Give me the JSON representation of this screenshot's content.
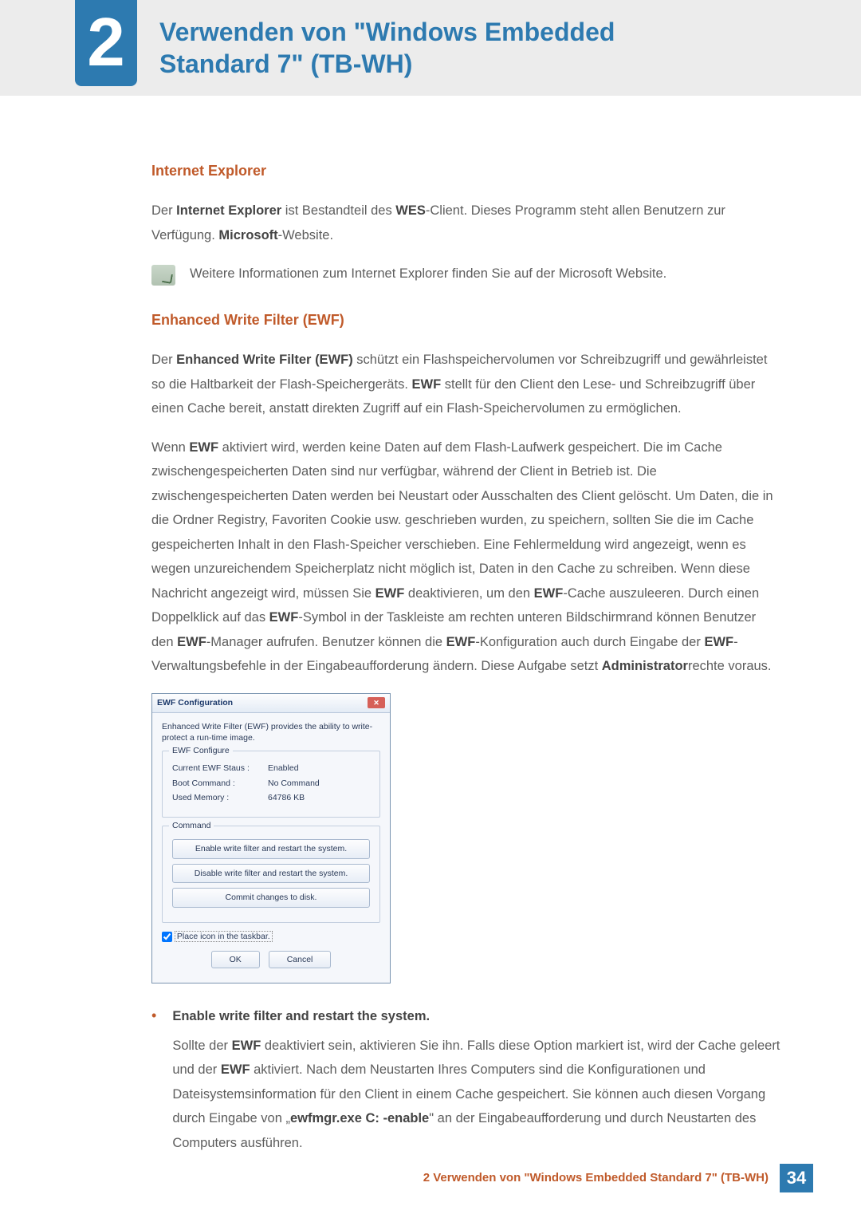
{
  "header": {
    "chapter_number": "2",
    "title_line1": "Verwenden von \"Windows Embedded",
    "title_line2": "Standard 7\" (TB-WH)"
  },
  "sections": {
    "ie": {
      "heading": "Internet Explorer",
      "para_prefix": "Der ",
      "para_b1": "Internet Explorer",
      "para_mid1": " ist Bestandteil des ",
      "para_b2": "WES",
      "para_mid2": "-Client. Dieses Programm steht allen Benutzern zur Verfügung. ",
      "para_b3": "Microsoft",
      "para_suffix": "-Website.",
      "note": "Weitere Informationen zum Internet Explorer finden Sie auf der Microsoft Website."
    },
    "ewf": {
      "heading": "Enhanced Write Filter (EWF)",
      "p1_a": "Der ",
      "p1_b1": "Enhanced Write Filter (EWF)",
      "p1_b": " schützt ein Flashspeichervolumen vor Schreibzugriff und gewährleistet so die Haltbarkeit der Flash-Speichergeräts. ",
      "p1_b2": "EWF",
      "p1_c": " stellt für den Client den Lese- und Schreibzugriff über einen Cache bereit, anstatt direkten Zugriff auf ein Flash-Speichervolumen zu ermöglichen.",
      "p2_a": "Wenn ",
      "p2_b1": "EWF",
      "p2_b": " aktiviert wird, werden keine Daten auf dem Flash-Laufwerk gespeichert. Die im Cache zwischengespeicherten Daten sind nur verfügbar, während der Client in Betrieb ist. Die zwischengespeicherten Daten werden bei Neustart oder Ausschalten des Client gelöscht. Um Daten, die in die Ordner Registry, Favoriten Cookie usw. geschrieben wurden, zu speichern, sollten Sie die im Cache gespeicherten Inhalt in den Flash-Speicher verschieben. Eine Fehlermeldung wird angezeigt, wenn es wegen unzureichendem Speicherplatz nicht möglich ist, Daten in den Cache zu schreiben. Wenn diese Nachricht angezeigt wird, müssen Sie ",
      "p2_b2": "EWF",
      "p2_c": " deaktivieren, um den ",
      "p2_b3": "EWF",
      "p2_d": "-Cache auszuleeren. Durch einen Doppelklick auf das ",
      "p2_b4": "EWF",
      "p2_e": "-Symbol in der Taskleiste am rechten unteren Bildschirmrand können Benutzer den ",
      "p2_b5": "EWF",
      "p2_f": "-Manager aufrufen. Benutzer können die ",
      "p2_b6": "EWF",
      "p2_g": "-Konfiguration auch durch Eingabe der ",
      "p2_b7": "EWF",
      "p2_h": "-Verwaltungsbefehle in der Eingabeaufforderung ändern. Diese Aufgabe setzt ",
      "p2_b8": "Administrator",
      "p2_i": "rechte voraus."
    }
  },
  "dialog": {
    "title": "EWF Configuration",
    "desc": "Enhanced Write Filter (EWF) provides the ability to write-protect a run-time image.",
    "group1": "EWF Configure",
    "status_k": "Current EWF Staus :",
    "status_v": "Enabled",
    "boot_k": "Boot Command :",
    "boot_v": "No Command",
    "mem_k": "Used Memory :",
    "mem_v": "64786 KB",
    "group2": "Command",
    "btn_enable": "Enable write filter and restart the system.",
    "btn_disable": "Disable write filter and restart the system.",
    "btn_commit": "Commit changes to disk.",
    "checkbox": "Place icon in the taskbar.",
    "ok": "OK",
    "cancel": "Cancel"
  },
  "bullet": {
    "title": "Enable write filter and restart the system.",
    "body_a": "Sollte der ",
    "body_b1": "EWF",
    "body_b": " deaktiviert sein, aktivieren Sie ihn. Falls diese Option markiert ist, wird der Cache geleert und der ",
    "body_b2": "EWF",
    "body_c": " aktiviert. Nach dem Neustarten Ihres Computers sind die Konfigurationen und Dateisystemsinformation für den Client in einem Cache gespeichert. Sie können auch diesen Vorgang durch Eingabe von „",
    "body_b3": "ewfmgr.exe C: -enable",
    "body_d": "\" an der Eingabeaufforderung und durch Neustarten des Computers ausführen."
  },
  "footer": {
    "text": "2 Verwenden von \"Windows Embedded Standard 7\" (TB-WH)",
    "page": "34"
  }
}
